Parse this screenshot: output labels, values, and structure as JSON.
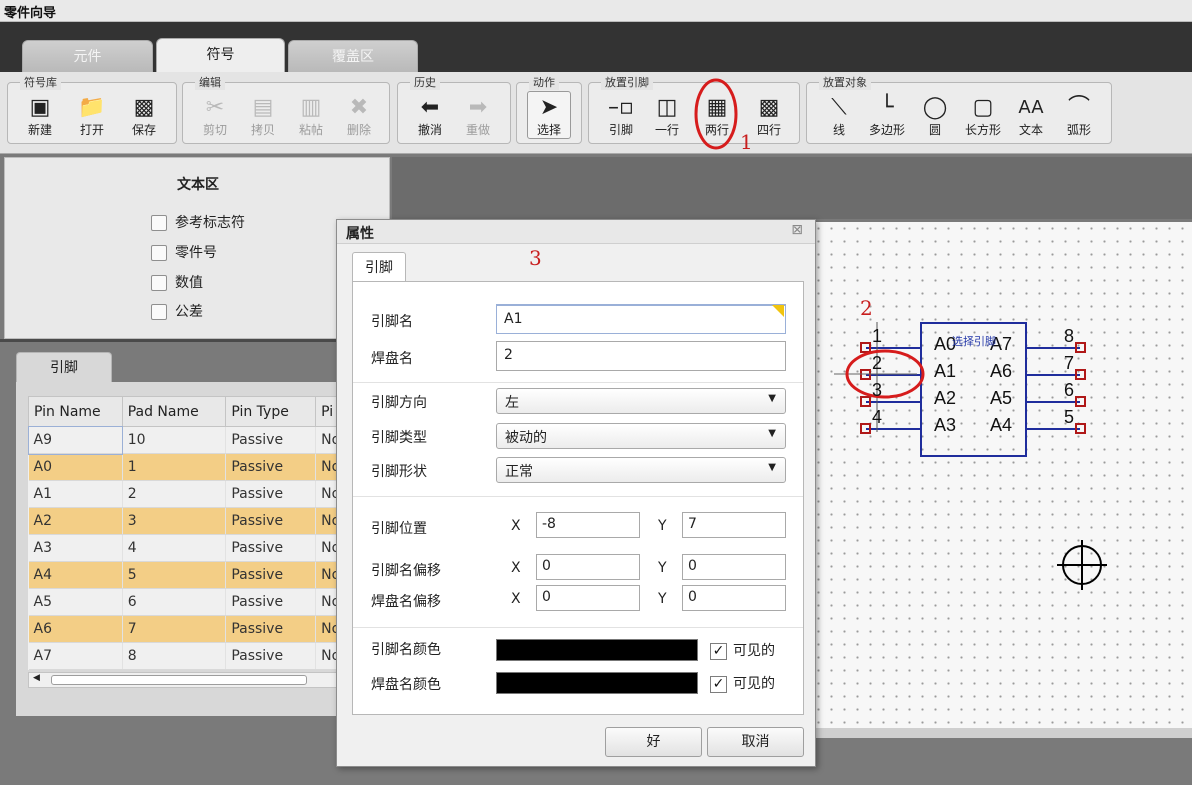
{
  "window": {
    "title": "零件向导"
  },
  "tabs": [
    "元件",
    "符号",
    "覆盖区"
  ],
  "toolbar": {
    "symbol_lib": {
      "label": "符号库",
      "buttons": [
        "新建",
        "打开",
        "保存"
      ]
    },
    "edit": {
      "label": "编辑",
      "buttons": [
        "剪切",
        "拷贝",
        "粘帖",
        "删除"
      ]
    },
    "history": {
      "label": "历史",
      "buttons": [
        "撤消",
        "重做"
      ]
    },
    "action": {
      "label": "动作",
      "buttons": [
        "选择"
      ]
    },
    "place_pin": {
      "label": "放置引脚",
      "buttons": [
        "引脚",
        "一行",
        "两行",
        "四行"
      ]
    },
    "place_obj": {
      "label": "放置对象",
      "buttons": [
        "线",
        "多边形",
        "圆",
        "长方形",
        "文本",
        "弧形"
      ]
    }
  },
  "text_area": {
    "title": "文本区",
    "options": [
      "参考标志符",
      "零件号",
      "数值",
      "公差"
    ]
  },
  "pin_panel": {
    "tab": "引脚",
    "columns": [
      "Pin Name",
      "Pad Name",
      "Pin Type",
      "Pi"
    ],
    "rows": [
      [
        "A9",
        "10",
        "Passive",
        "No"
      ],
      [
        "A0",
        "1",
        "Passive",
        "No"
      ],
      [
        "A1",
        "2",
        "Passive",
        "No"
      ],
      [
        "A2",
        "3",
        "Passive",
        "No"
      ],
      [
        "A3",
        "4",
        "Passive",
        "No"
      ],
      [
        "A4",
        "5",
        "Passive",
        "No"
      ],
      [
        "A5",
        "6",
        "Passive",
        "No"
      ],
      [
        "A6",
        "7",
        "Passive",
        "No"
      ],
      [
        "A7",
        "8",
        "Passive",
        "No"
      ]
    ]
  },
  "dialog": {
    "title": "属性",
    "close": "⊠",
    "tab": "引脚",
    "pin_name_label": "引脚名",
    "pin_name_value": "A1",
    "pad_name_label": "焊盘名",
    "pad_name_value": "2",
    "direction_label": "引脚方向",
    "direction_value": "左",
    "type_label": "引脚类型",
    "type_value": "被动的",
    "shape_label": "引脚形状",
    "shape_value": "正常",
    "position_label": "引脚位置",
    "name_offset_label": "引脚名偏移",
    "pad_offset_label": "焊盘名偏移",
    "x_label": "X",
    "y_label": "Y",
    "position_x": "-8",
    "position_y": "7",
    "name_offset_x": "0",
    "name_offset_y": "0",
    "pad_offset_x": "0",
    "pad_offset_y": "0",
    "name_color_label": "引脚名颜色",
    "pad_color_label": "焊盘名颜色",
    "visible_label": "可见的",
    "ok": "好",
    "cancel": "取消",
    "name_color": "#000000",
    "pad_color": "#000000"
  },
  "canvas": {
    "left_numbers": [
      "1",
      "2",
      "3",
      "4"
    ],
    "right_numbers": [
      "8",
      "7",
      "6",
      "5"
    ],
    "left_pins": [
      "A0",
      "A1",
      "A2",
      "A3"
    ],
    "right_pins": [
      "A7",
      "A6",
      "A5",
      "A4"
    ],
    "tooltip": "选择引脚"
  },
  "annotations": [
    "1",
    "2",
    "3"
  ],
  "colors": {
    "annotation_red": "#c81e1e",
    "pin_stub_blue": "#1f2d9c",
    "pad_red": "#b01818",
    "row_highlight": "#f3ce86"
  }
}
